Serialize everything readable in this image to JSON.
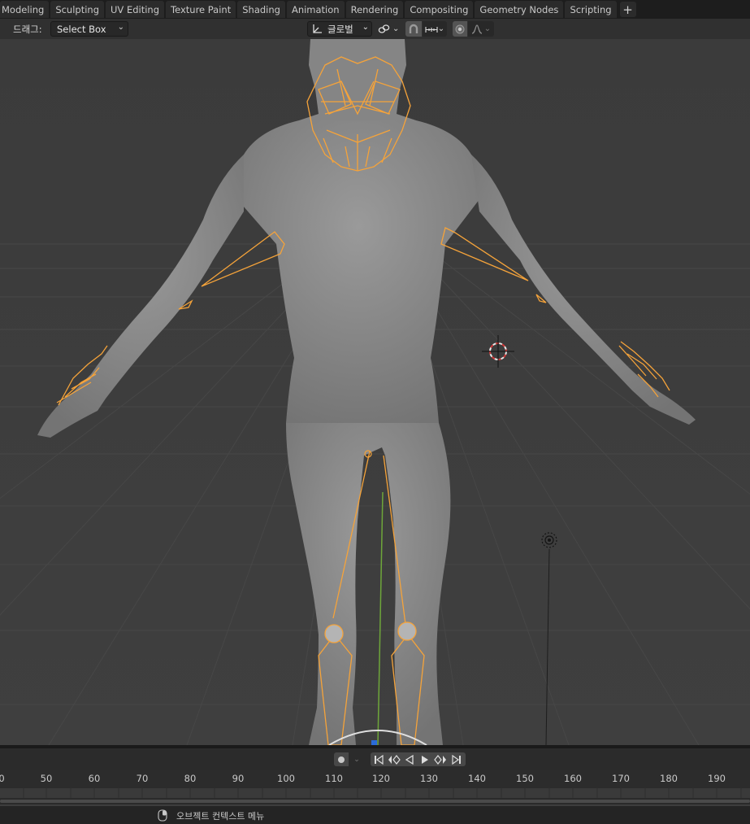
{
  "workspace_tabs": [
    {
      "label": "Modeling"
    },
    {
      "label": "Sculpting"
    },
    {
      "label": "UV Editing"
    },
    {
      "label": "Texture Paint"
    },
    {
      "label": "Shading"
    },
    {
      "label": "Animation"
    },
    {
      "label": "Rendering"
    },
    {
      "label": "Compositing"
    },
    {
      "label": "Geometry Nodes"
    },
    {
      "label": "Scripting"
    }
  ],
  "add_tab_label": "+",
  "header": {
    "drag_label": "드래그:",
    "select_mode": "Select Box",
    "orientation": "글로벌",
    "pivot_icon": "link-icon",
    "snap_icon": "magnet-icon",
    "proportional_icon": "proportional-edit-icon",
    "falloff_icon": "falloff-curve-icon"
  },
  "timeline": {
    "ticks": [
      "0",
      "50",
      "60",
      "70",
      "80",
      "90",
      "100",
      "110",
      "120",
      "130",
      "140",
      "150",
      "160",
      "170",
      "180",
      "190"
    ],
    "current_frame_marker": "120",
    "controls": [
      "jump-start-icon",
      "prev-keyframe-icon",
      "play-reverse-icon",
      "play-icon",
      "next-keyframe-icon",
      "jump-end-icon"
    ]
  },
  "status": {
    "mouse_icon": "mouse-icon",
    "text": "오브젝트 컨텍스트 메뉴"
  },
  "colors": {
    "viewport_bg": "#3d3d3d",
    "armature_orange": "#f5a33a",
    "y_axis_green": "#6ea63a",
    "mesh_gray": "#8c8c8c"
  }
}
